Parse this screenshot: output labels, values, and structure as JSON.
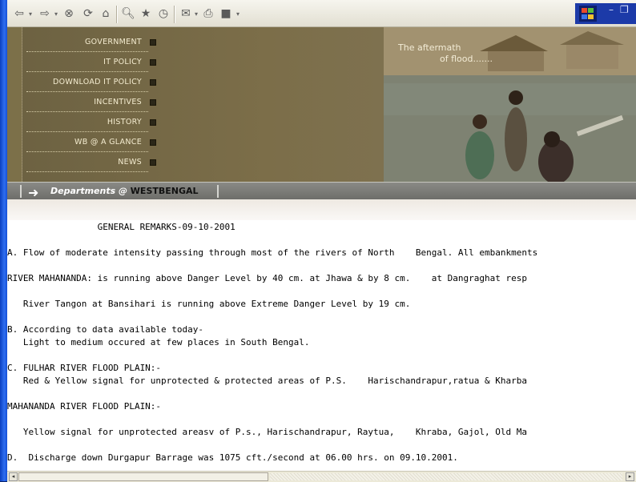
{
  "toolbar": {
    "buttons": [
      "back",
      "forward",
      "stop",
      "refresh",
      "home",
      "search",
      "favorites",
      "history",
      "mail",
      "print",
      "edit"
    ]
  },
  "menu": {
    "items": [
      "GOVERNMENT",
      "IT POLICY",
      "DOWNLOAD IT POLICY",
      "INCENTIVES",
      "HISTORY",
      "WB @ A GLANCE",
      "NEWS"
    ]
  },
  "banner": {
    "caption_line1": "The aftermath",
    "caption_line2": "of flood......."
  },
  "departments_bar": {
    "label_prefix": "Departments @ ",
    "label_bold": "WESTBENGAL"
  },
  "content": {
    "lines": [
      "                 GENERAL REMARKS-09-10-2001",
      "A. Flow of moderate intensity passing through most of the rivers of North    Bengal. All embankments",
      "RIVER MAHANANDA: is running above Danger Level by 40 cm. at Jhawa & by 8 cm.    at Dangraghat resp",
      "   River Tangon at Bansihari is running above Extreme Danger Level by 19 cm.",
      "B. According to data available today-",
      "   Light to medium occured at few places in South Bengal.",
      "C. FULHAR RIVER FLOOD PLAIN:-",
      "   Red & Yellow signal for unprotected & protected areas of P.S.    Harischandrapur,ratua & Kharba",
      "MAHANANDA RIVER FLOOD PLAIN:-",
      "   Yellow signal for unprotected areasv of P.s., Harischandrapur, Raytua,    Khraba, Gajol, Old Ma",
      "D.  Discharge down Durgapur Barrage was 1075 cft./second at 06.00 hrs. on 09.10.2001."
    ]
  }
}
